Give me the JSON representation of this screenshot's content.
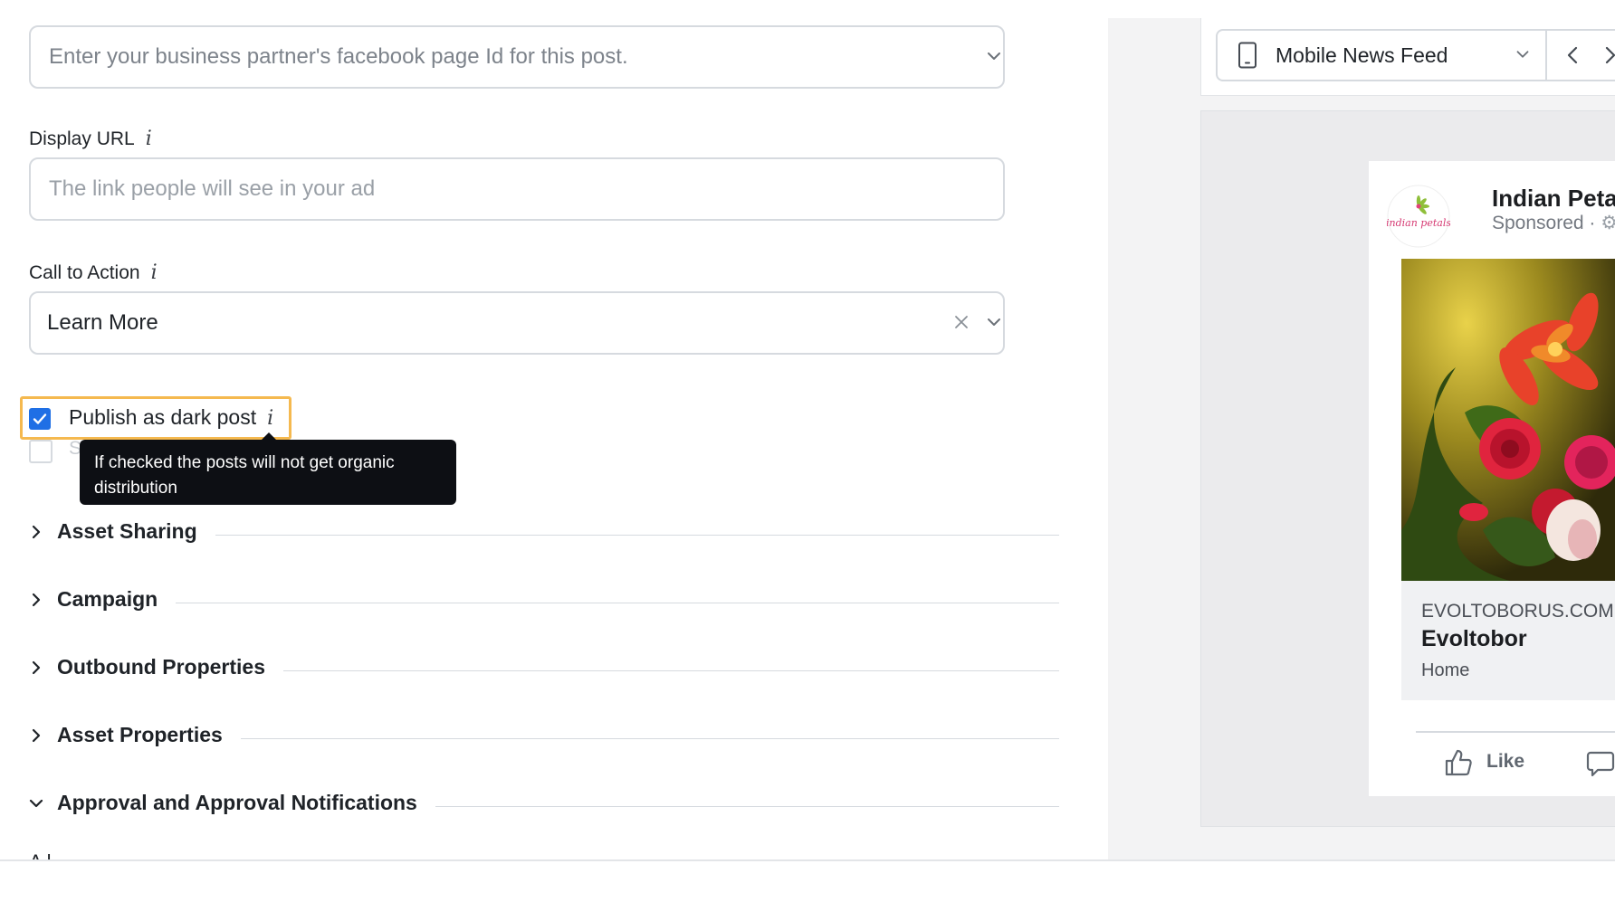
{
  "form": {
    "partner_page": {
      "placeholder": "Enter your business partner's facebook page Id for this post."
    },
    "display_url": {
      "label": "Display URL",
      "info": "i",
      "placeholder": "The link people will see in your ad"
    },
    "call_to_action": {
      "label": "Call to Action",
      "info": "i",
      "value": "Learn More"
    },
    "dark_post": {
      "label": "Publish as dark post",
      "info": "i",
      "checked": true,
      "tooltip": "If checked the posts will not get organic distribution"
    },
    "hidden_option": {
      "label": "S",
      "checked": false
    }
  },
  "sections": [
    {
      "title": "Asset Sharing",
      "expanded": false
    },
    {
      "title": "Campaign",
      "expanded": false
    },
    {
      "title": "Outbound Properties",
      "expanded": false
    },
    {
      "title": "Asset Properties",
      "expanded": false
    },
    {
      "title": "Approval and Approval Notifications",
      "expanded": true
    }
  ],
  "cut_off_text": "A       l",
  "preview": {
    "placement": "Mobile News Feed",
    "page_name": "Indian Petal",
    "sponsored": "Sponsored · ",
    "logo_text": "indian petals",
    "link": {
      "domain": "EVOLTOBORUS.COM",
      "headline": "Evoltobor",
      "description": "Home"
    },
    "actions": {
      "like": "Like"
    }
  },
  "colors": {
    "accent": "#1f6fe5",
    "highlight": "#f5b94f",
    "tooltip_bg": "#0d0f14",
    "border": "#d6dadf"
  },
  "icons": [
    "chevron-down-icon",
    "clear-icon",
    "info-icon",
    "check-icon",
    "chevron-right-icon",
    "phone-icon",
    "chevron-left-icon",
    "gear-icon",
    "like-icon",
    "comment-icon"
  ]
}
